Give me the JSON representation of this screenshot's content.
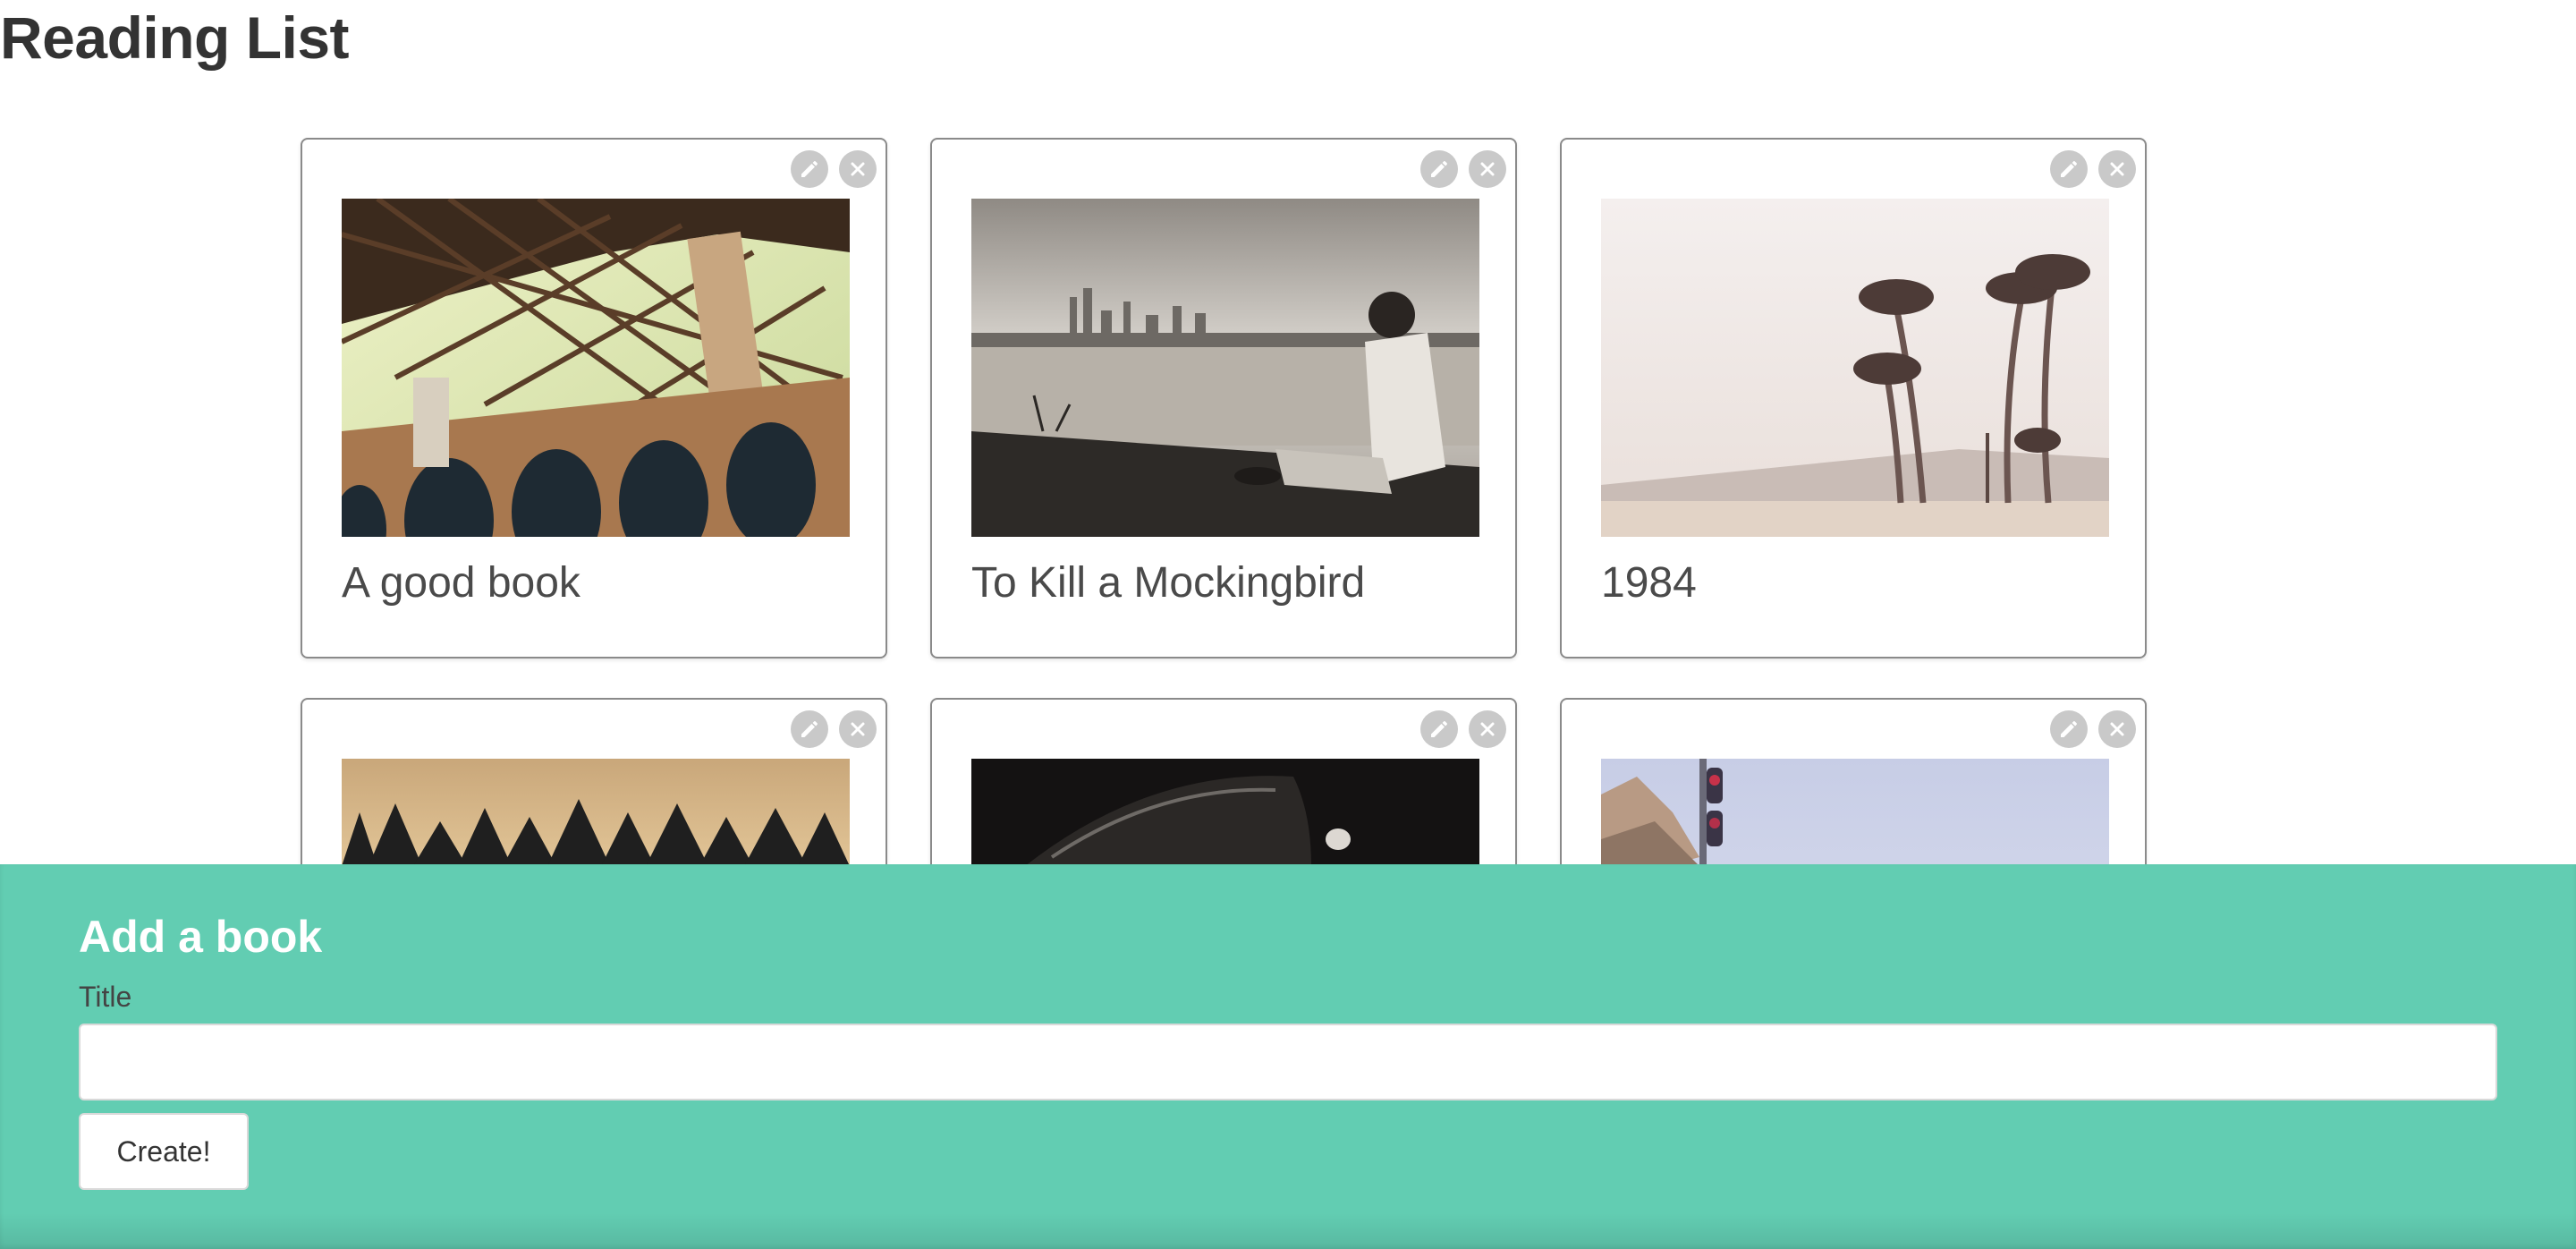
{
  "page": {
    "title": "Reading List"
  },
  "books": [
    {
      "title": "A good book",
      "image": "golden-gate-bridge-photo",
      "edit_icon": "pencil-icon",
      "delete_icon": "close-icon"
    },
    {
      "title": "To Kill a Mockingbird",
      "image": "man-by-lake-city-skyline-photo",
      "edit_icon": "pencil-icon",
      "delete_icon": "close-icon"
    },
    {
      "title": "1984",
      "image": "palm-trees-beach-photo",
      "edit_icon": "pencil-icon",
      "delete_icon": "close-icon"
    },
    {
      "title": "",
      "image": "forest-sunset-photo",
      "edit_icon": "pencil-icon",
      "delete_icon": "close-icon"
    },
    {
      "title": "",
      "image": "vintage-car-dark-photo",
      "edit_icon": "pencil-icon",
      "delete_icon": "close-icon"
    },
    {
      "title": "",
      "image": "cliff-signal-light-photo",
      "edit_icon": "pencil-icon",
      "delete_icon": "close-icon"
    }
  ],
  "add_form": {
    "heading": "Add a book",
    "title_label": "Title",
    "title_value": "",
    "title_placeholder": "",
    "submit_label": "Create!"
  },
  "colors": {
    "panel_bg": "#62cdb2",
    "icon_bg": "#c9c9c9",
    "card_border": "#8a8a8a"
  }
}
